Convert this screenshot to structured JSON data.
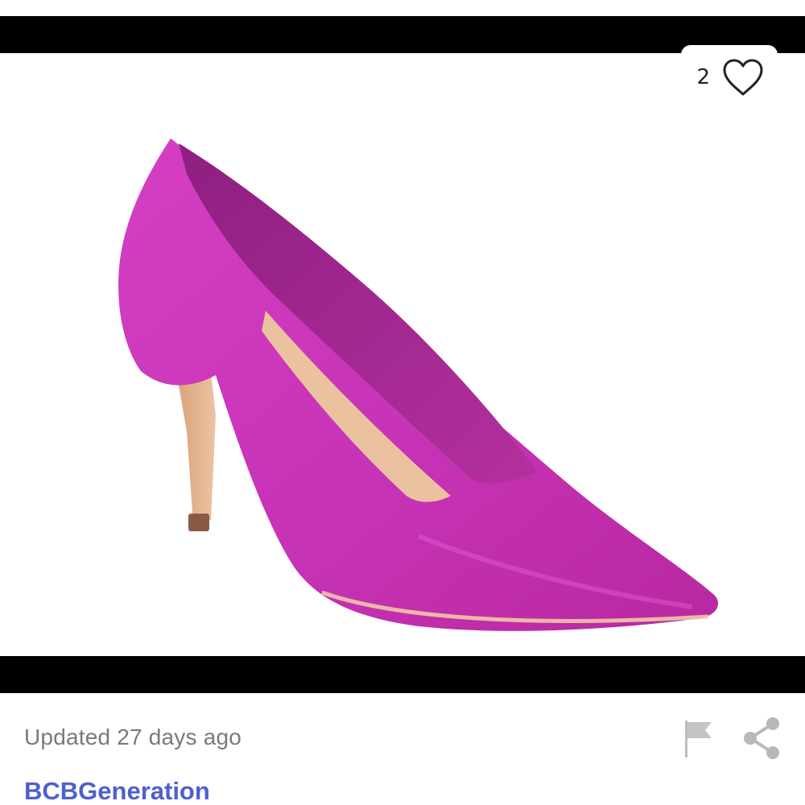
{
  "listing": {
    "like_count": "2",
    "updated_text": "Updated 27 days ago",
    "brand": "BCBGeneration"
  },
  "carousel": {
    "dot_count": 4,
    "active_index": 1
  },
  "icons": {
    "like": "heart-outline-icon",
    "report": "flag-icon",
    "share": "share-icon"
  },
  "colors": {
    "brand_link": "#4e5fd0",
    "shoe": "#c935b8",
    "muted_text": "#7a7a7a"
  }
}
